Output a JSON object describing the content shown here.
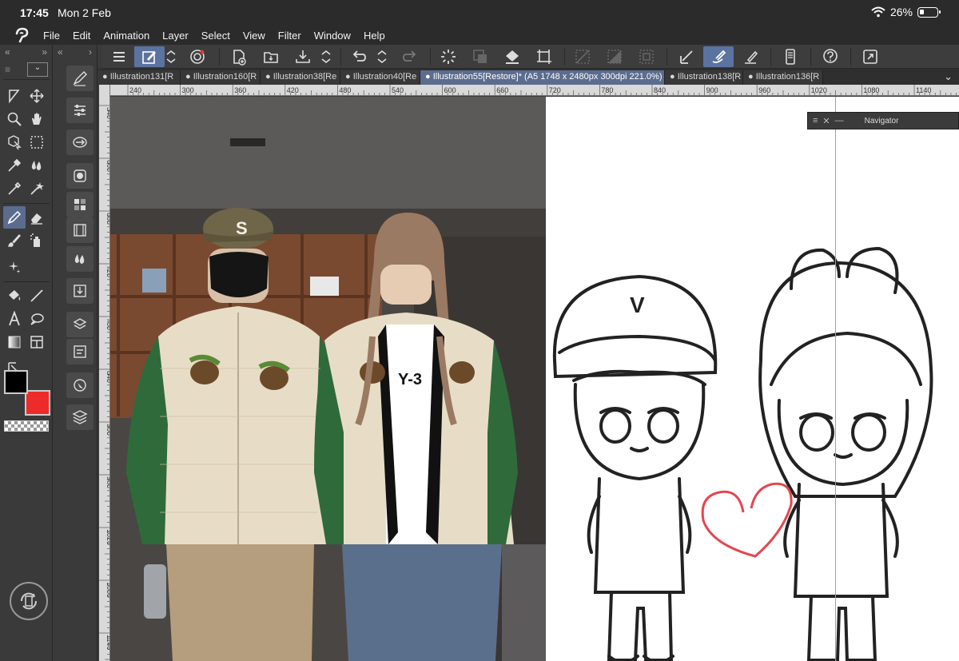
{
  "status": {
    "time": "17:45",
    "date": "Mon 2 Feb",
    "battery": "26%",
    "battery_level": 0.26
  },
  "menu": [
    "File",
    "Edit",
    "Animation",
    "Layer",
    "Select",
    "View",
    "Filter",
    "Window",
    "Help"
  ],
  "tabs": [
    {
      "label": "Illustration131[R",
      "active": false
    },
    {
      "label": "Illustration160[R",
      "active": false
    },
    {
      "label": "Illustration38[Re",
      "active": false
    },
    {
      "label": "Illustration40[Re",
      "active": false
    },
    {
      "label": "Illustration55[Restore]* (A5 1748 x 2480px 300dpi 221.0%)",
      "active": true
    },
    {
      "label": "Illustration138[R",
      "active": false
    },
    {
      "label": "Illustration136[R",
      "active": false
    }
  ],
  "ruler_h": [
    "240",
    "300",
    "360",
    "420",
    "480",
    "540",
    "600",
    "660",
    "720",
    "780",
    "840",
    "900",
    "960",
    "1020",
    "1080",
    "1140"
  ],
  "ruler_v": [
    "540",
    "600",
    "660",
    "720",
    "780",
    "840",
    "900",
    "960",
    "1020",
    "1080",
    "1140"
  ],
  "navigator": {
    "title": "Navigator"
  },
  "colors": {
    "main": "#000000",
    "sub": "#ee2b2b",
    "accent": "#5b73a0",
    "heart": "#e5464f"
  },
  "photo": {
    "cap_letter": "S",
    "shirt_text": "Y-3"
  },
  "sketch": {
    "hat_letter": "V"
  }
}
